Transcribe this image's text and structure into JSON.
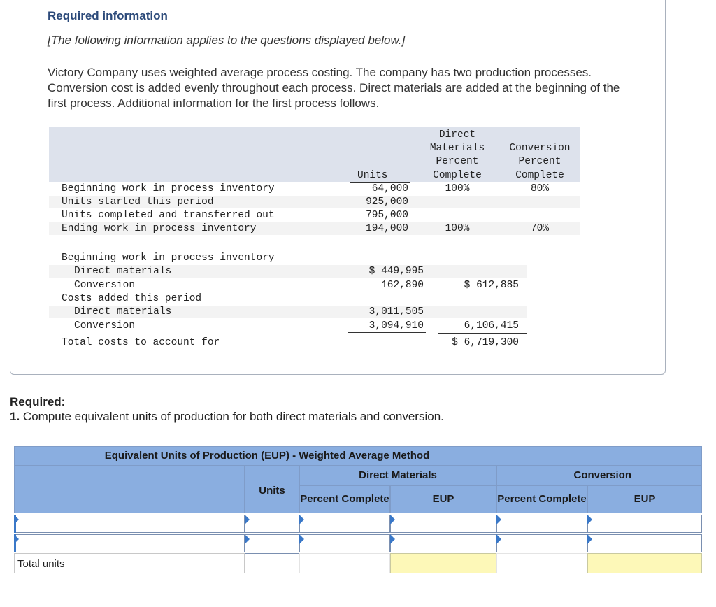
{
  "info": {
    "title": "Required information",
    "subtitle": "[The following information applies to the questions displayed below.]",
    "paragraph": "Victory Company uses weighted average process costing. The company has two production processes. Conversion cost is added evenly throughout each process. Direct materials are added at the beginning of the first process. Additional information for the first process follows."
  },
  "units_table": {
    "col_units": "Units",
    "col_dm": [
      "Direct",
      "Materials",
      "Percent",
      "Complete"
    ],
    "col_conv": [
      "Conversion",
      "Percent",
      "Complete"
    ],
    "rows": [
      {
        "label": "Beginning work in process inventory",
        "units": "64,000",
        "dm": "100%",
        "conv": "80%"
      },
      {
        "label": "Units started this period",
        "units": "925,000",
        "dm": "",
        "conv": ""
      },
      {
        "label": "Units completed and transferred out",
        "units": "795,000",
        "dm": "",
        "conv": ""
      },
      {
        "label": "Ending work in process inventory",
        "units": "194,000",
        "dm": "100%",
        "conv": "70%"
      }
    ]
  },
  "cost_table": {
    "beg_label": "Beginning work in process inventory",
    "beg_dm_label": "Direct materials",
    "beg_dm": "$ 449,995",
    "beg_conv_label": "Conversion",
    "beg_conv": "162,890",
    "beg_total": "$ 612,885",
    "added_label": "Costs added this period",
    "add_dm_label": "Direct materials",
    "add_dm": "3,011,505",
    "add_conv_label": "Conversion",
    "add_conv": "3,094,910",
    "add_total": "6,106,415",
    "total_label": "Total costs to account for",
    "total": "$ 6,719,300"
  },
  "required": {
    "title": "Required:",
    "num": "1.",
    "question": "Compute equivalent units of production for both direct materials and conversion."
  },
  "eup": {
    "title": "Equivalent Units of Production (EUP) - Weighted Average Method",
    "dm_header": "Direct Materials",
    "conv_header": "Conversion",
    "units": "Units",
    "pct_complete": "Percent Complete",
    "eup": "EUP",
    "total_units": "Total units"
  },
  "colors": {
    "header_blue": "#8aaee0",
    "yellow": "#fdf8b8",
    "title_blue": "#2c4a7a"
  }
}
